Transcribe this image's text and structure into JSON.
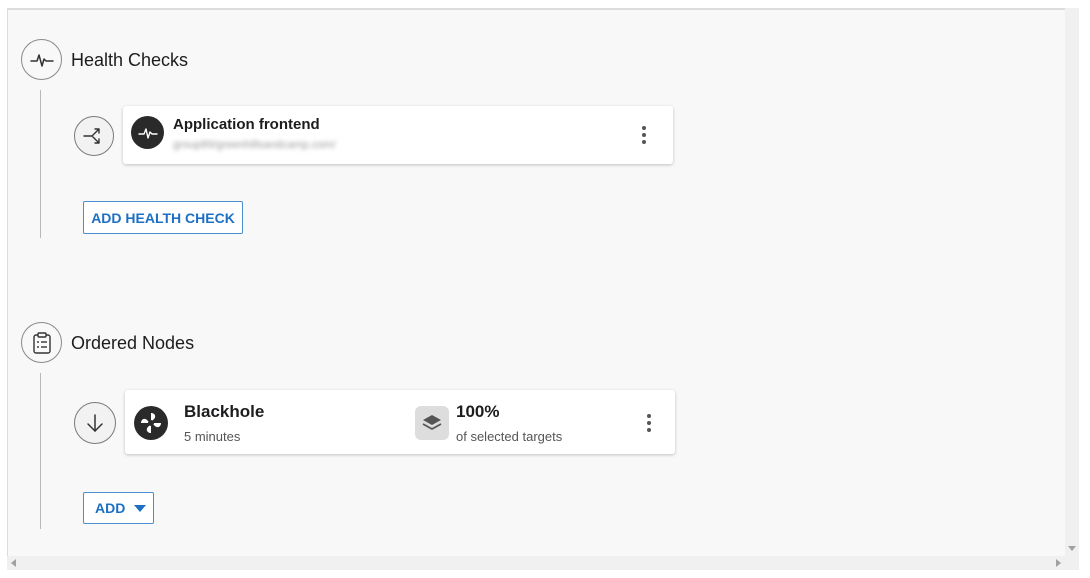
{
  "health_checks": {
    "title": "Health Checks",
    "item": {
      "title": "Application frontend",
      "url": "group89/greenhillsandcamp.com/"
    },
    "add_button": "ADD HEALTH CHECK"
  },
  "ordered_nodes": {
    "title": "Ordered Nodes",
    "node": {
      "title": "Blackhole",
      "duration": "5 minutes",
      "percent": "100%",
      "percent_label": "of selected targets"
    },
    "add_button": "ADD"
  },
  "icons": {
    "health_section": "heartbeat-icon",
    "branch": "branch-icon",
    "health_item": "heartbeat-icon",
    "nodes_section": "clipboard-list-icon",
    "down_arrow": "arrow-down-icon",
    "blackhole": "blackhole-icon",
    "layers": "layers-icon",
    "kebab": "kebab-menu-icon"
  },
  "colors": {
    "accent": "#1d6fc4",
    "dark_icon": "#2a2a2a"
  }
}
